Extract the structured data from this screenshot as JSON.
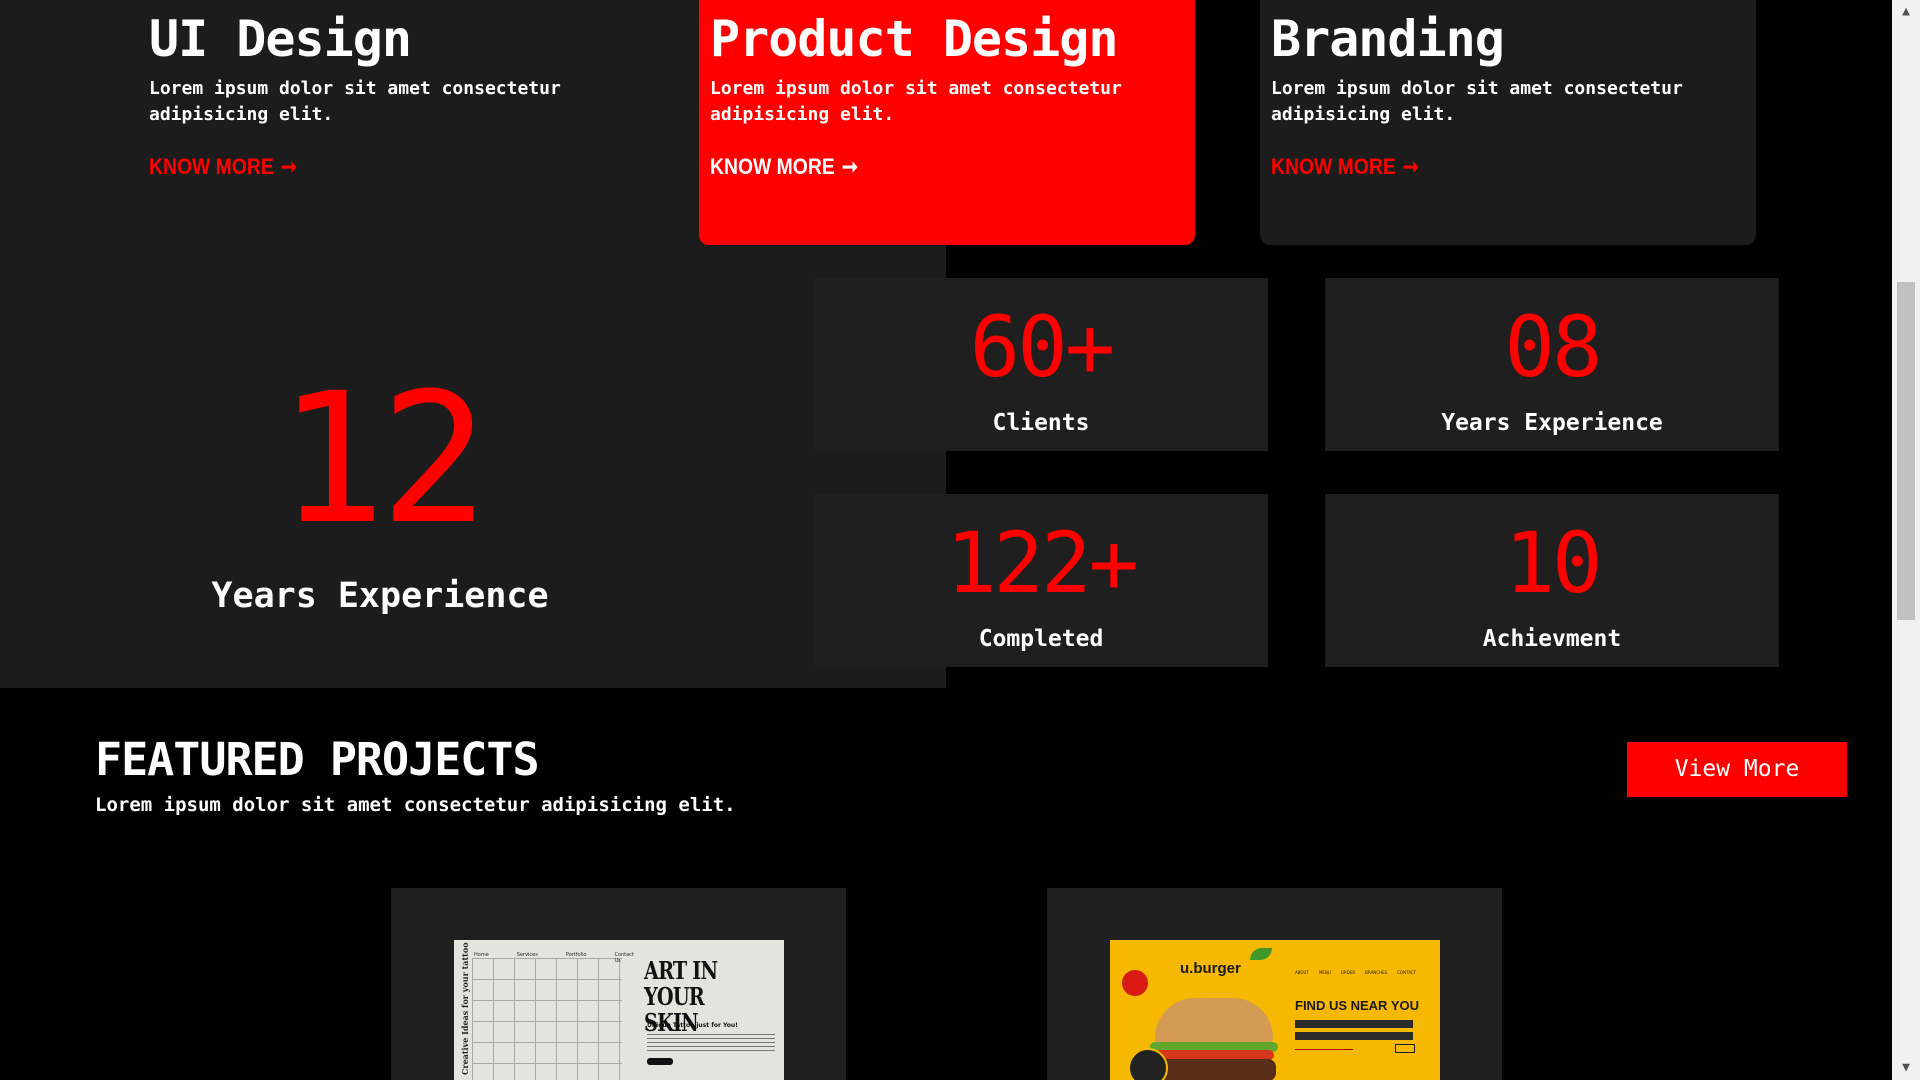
{
  "services": [
    {
      "title": "UI Design",
      "text": "Lorem ipsum dolor sit amet consectetur adipisicing elit.",
      "link": "KNOW MORE"
    },
    {
      "title": "Product Design",
      "text": "Lorem ipsum dolor sit amet consectetur adipisicing elit.",
      "link": "KNOW MORE"
    },
    {
      "title": "Branding",
      "text": "Lorem ipsum dolor sit amet consectetur adipisicing elit.",
      "link": "KNOW MORE"
    }
  ],
  "experience": {
    "number": "12",
    "label": "Years Experience"
  },
  "stats": [
    {
      "number": "60+",
      "label": "Clients"
    },
    {
      "number": "08",
      "label": "Years Experience"
    },
    {
      "number": "122+",
      "label": "Completed"
    },
    {
      "number": "10",
      "label": "Achievment"
    }
  ],
  "featured": {
    "title": "FEATURED PROJECTS",
    "subtitle": "Lorem ipsum dolor sit amet consectetur adipisicing elit.",
    "button": "View More"
  },
  "projects": [
    {
      "nav": [
        "Home",
        "Services",
        "Portfolio",
        "Contact Us"
      ],
      "side_text": "Creative Ideas for your tattoo",
      "headline": "ART IN YOUR SKIN",
      "tagline": "Unique Tattoo just for You!"
    },
    {
      "logo": "u.burger",
      "menu": [
        "ABOUT",
        "MENU",
        "ORDER",
        "BRANCHES",
        "CONTACT"
      ],
      "headline": "FIND US NEAR YOU"
    }
  ],
  "colors": {
    "accent": "#ff0000",
    "background": "#000000",
    "card": "#1c1c1c"
  }
}
